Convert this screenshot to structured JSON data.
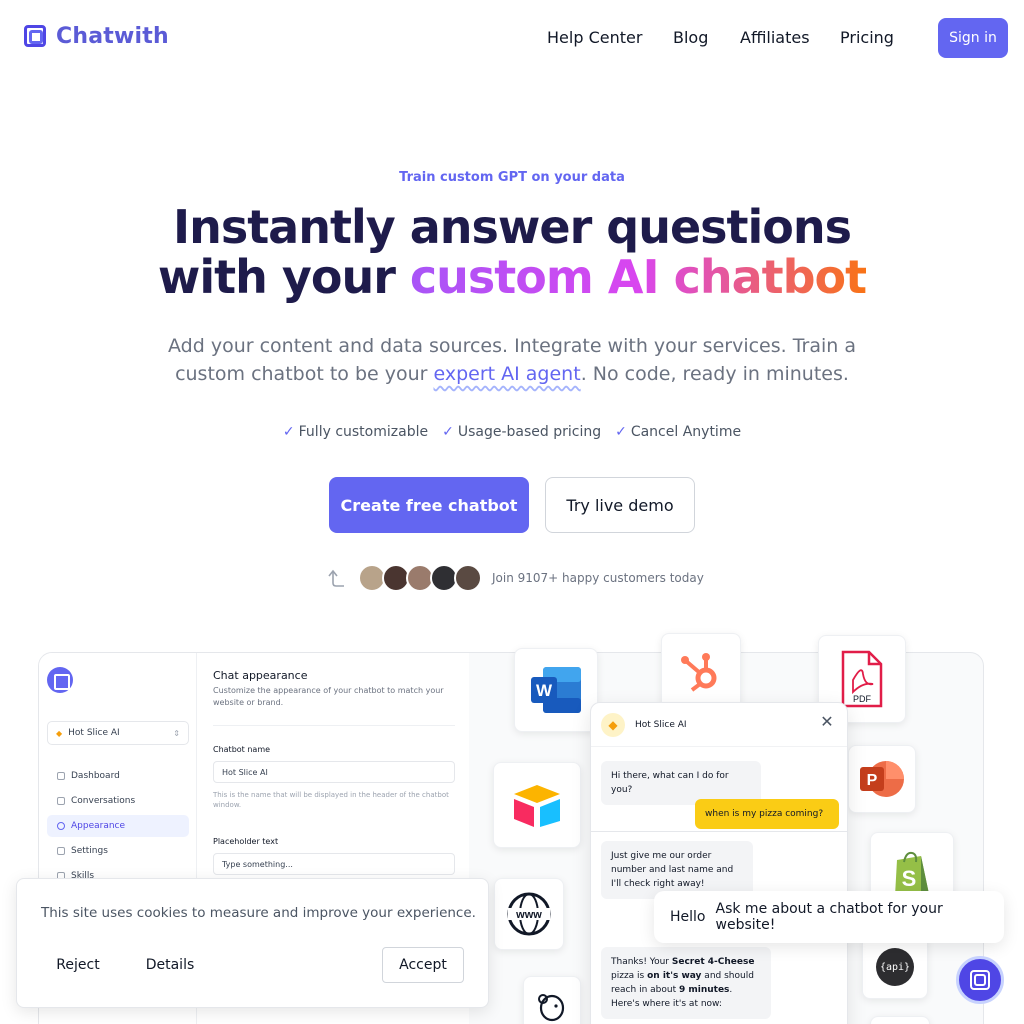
{
  "header": {
    "brand": "Chatwith",
    "nav": [
      {
        "label": "Help Center"
      },
      {
        "label": "Blog"
      },
      {
        "label": "Affiliates"
      },
      {
        "label": "Pricing"
      }
    ],
    "signin_label": "Sign in"
  },
  "hero": {
    "eyebrow": "Train custom GPT on your data",
    "headline_line1": "Instantly answer questions",
    "headline_line2_plain": "with your ",
    "headline_line2_gradient": "custom AI chatbot",
    "sub_before": "Add your content and data sources. Integrate with your services. Train a custom chatbot to be your ",
    "sub_link": "expert AI agent",
    "sub_after": ". No code, ready in minutes.",
    "checks": [
      "Fully customizable",
      "Usage-based pricing",
      "Cancel Anytime"
    ],
    "cta_primary": "Create free chatbot",
    "cta_secondary": "Try live demo",
    "social_proof": "Join 9107+ happy customers today"
  },
  "preview": {
    "selected_bot": "Hot Slice AI",
    "sidebar_items": [
      "Dashboard",
      "Conversations",
      "Appearance",
      "Settings",
      "Skills"
    ],
    "settings": {
      "title": "Chat appearance",
      "description": "Customize the appearance of your chatbot to match your website or brand.",
      "name_label": "Chatbot name",
      "name_value": "Hot Slice AI",
      "name_help": "This is the name that will be displayed in the header of the chatbot window.",
      "placeholder_label": "Placeholder text",
      "placeholder_value": "Type something..."
    },
    "chat": {
      "bot_name": "Hot Slice AI",
      "msg1": "Hi there, what can I do for you?",
      "msg2": "when is my pizza coming?",
      "msg3": "Just give me our order number and last name and I'll check right away!",
      "msg4_a": "Thanks! Your ",
      "msg4_b": "Secret 4-Cheese",
      "msg4_c": " pizza is ",
      "msg4_d": "on it's way",
      "msg4_e": " and should reach in about ",
      "msg4_f": "9 minutes",
      "msg4_g": ". Here's where it's at now:"
    },
    "integrations": [
      "word-icon",
      "hubspot-icon",
      "pdf-icon",
      "airtable-icon",
      "powerpoint-icon",
      "www-icon",
      "shopify-icon",
      "api-icon",
      "mailchimp-icon"
    ],
    "pdf_label": "PDF",
    "api_label": "{api}",
    "www_label": "www"
  },
  "cookie": {
    "text": "This site uses cookies to measure and improve your experience.",
    "reject": "Reject",
    "details": "Details",
    "accept": "Accept"
  },
  "widget": {
    "hello": "Hello",
    "prompt": "Ask me about a chatbot for your website!"
  },
  "colors": {
    "brand": "#6366f1",
    "headline": "#1e1b4b",
    "gradient_start": "#a855f7",
    "gradient_end": "#f97316"
  }
}
